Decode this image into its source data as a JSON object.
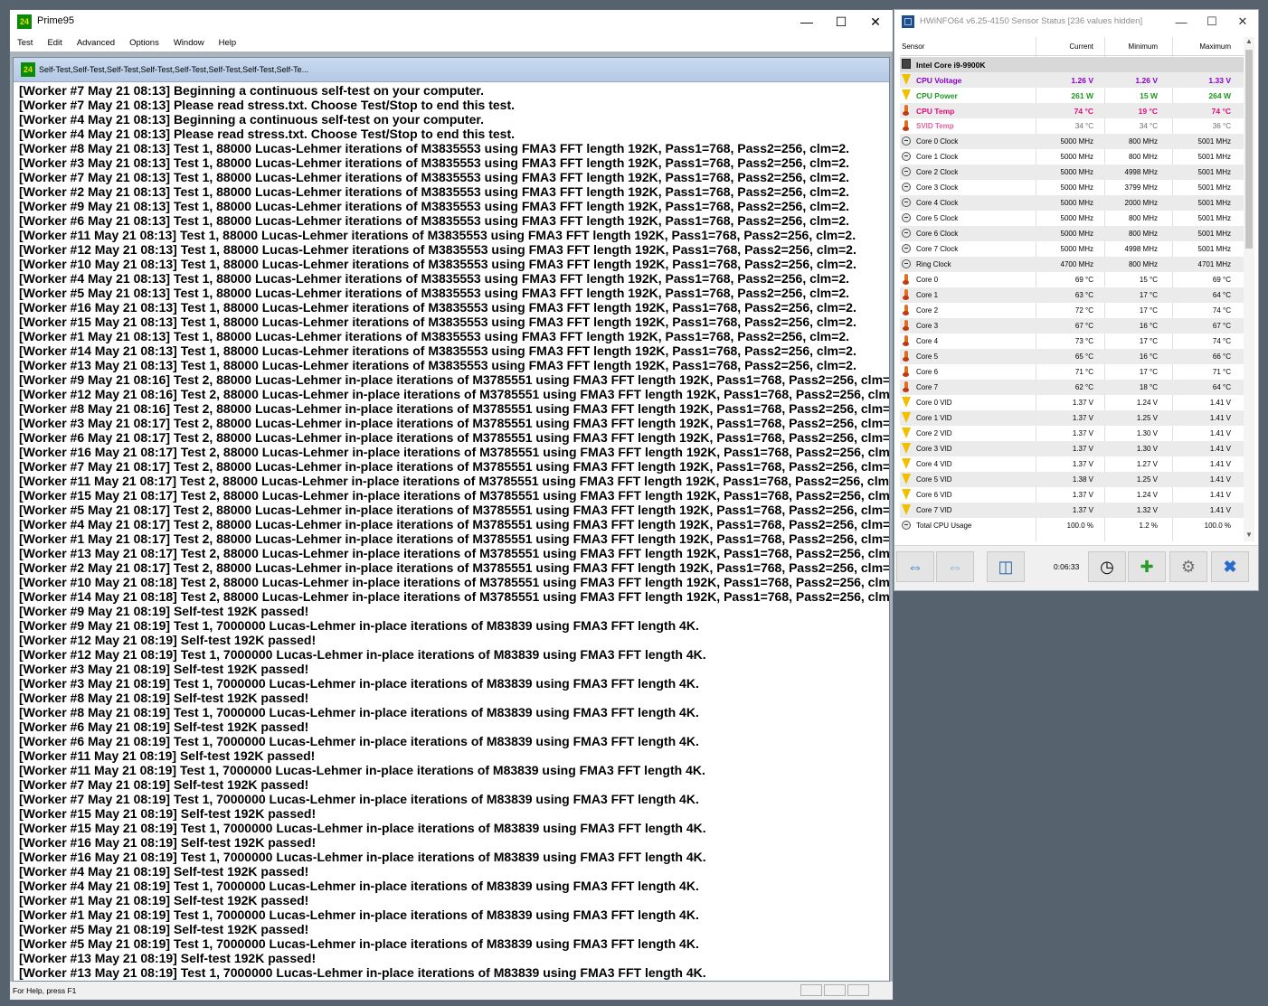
{
  "prime95": {
    "title": "Prime95",
    "menu": [
      "Test",
      "Edit",
      "Advanced",
      "Options",
      "Window",
      "Help"
    ],
    "child_title": "Self-Test,Self-Test,Self-Test,Self-Test,Self-Test,Self-Test,Self-Test,Self-Te...",
    "status_text": "For Help, press F1",
    "log": [
      "[Worker #7 May 21 08:13] Beginning a continuous self-test on your computer.",
      "[Worker #7 May 21 08:13] Please read stress.txt.  Choose Test/Stop to end this test.",
      "[Worker #4 May 21 08:13] Beginning a continuous self-test on your computer.",
      "[Worker #4 May 21 08:13] Please read stress.txt.  Choose Test/Stop to end this test.",
      "[Worker #8 May 21 08:13] Test 1, 88000 Lucas-Lehmer iterations of M3835553 using FMA3 FFT length 192K, Pass1=768, Pass2=256, clm=2.",
      "[Worker #3 May 21 08:13] Test 1, 88000 Lucas-Lehmer iterations of M3835553 using FMA3 FFT length 192K, Pass1=768, Pass2=256, clm=2.",
      "[Worker #7 May 21 08:13] Test 1, 88000 Lucas-Lehmer iterations of M3835553 using FMA3 FFT length 192K, Pass1=768, Pass2=256, clm=2.",
      "[Worker #2 May 21 08:13] Test 1, 88000 Lucas-Lehmer iterations of M3835553 using FMA3 FFT length 192K, Pass1=768, Pass2=256, clm=2.",
      "[Worker #9 May 21 08:13] Test 1, 88000 Lucas-Lehmer iterations of M3835553 using FMA3 FFT length 192K, Pass1=768, Pass2=256, clm=2.",
      "[Worker #6 May 21 08:13] Test 1, 88000 Lucas-Lehmer iterations of M3835553 using FMA3 FFT length 192K, Pass1=768, Pass2=256, clm=2.",
      "[Worker #11 May 21 08:13] Test 1, 88000 Lucas-Lehmer iterations of M3835553 using FMA3 FFT length 192K, Pass1=768, Pass2=256, clm=2.",
      "[Worker #12 May 21 08:13] Test 1, 88000 Lucas-Lehmer iterations of M3835553 using FMA3 FFT length 192K, Pass1=768, Pass2=256, clm=2.",
      "[Worker #10 May 21 08:13] Test 1, 88000 Lucas-Lehmer iterations of M3835553 using FMA3 FFT length 192K, Pass1=768, Pass2=256, clm=2.",
      "[Worker #4 May 21 08:13] Test 1, 88000 Lucas-Lehmer iterations of M3835553 using FMA3 FFT length 192K, Pass1=768, Pass2=256, clm=2.",
      "[Worker #5 May 21 08:13] Test 1, 88000 Lucas-Lehmer iterations of M3835553 using FMA3 FFT length 192K, Pass1=768, Pass2=256, clm=2.",
      "[Worker #16 May 21 08:13] Test 1, 88000 Lucas-Lehmer iterations of M3835553 using FMA3 FFT length 192K, Pass1=768, Pass2=256, clm=2.",
      "[Worker #15 May 21 08:13] Test 1, 88000 Lucas-Lehmer iterations of M3835553 using FMA3 FFT length 192K, Pass1=768, Pass2=256, clm=2.",
      "[Worker #1 May 21 08:13] Test 1, 88000 Lucas-Lehmer iterations of M3835553 using FMA3 FFT length 192K, Pass1=768, Pass2=256, clm=2.",
      "[Worker #14 May 21 08:13] Test 1, 88000 Lucas-Lehmer iterations of M3835553 using FMA3 FFT length 192K, Pass1=768, Pass2=256, clm=2.",
      "[Worker #13 May 21 08:13] Test 1, 88000 Lucas-Lehmer iterations of M3835553 using FMA3 FFT length 192K, Pass1=768, Pass2=256, clm=2.",
      "[Worker #9 May 21 08:16] Test 2, 88000 Lucas-Lehmer in-place iterations of M3785551 using FMA3 FFT length 192K, Pass1=768, Pass2=256, clm=2",
      "[Worker #12 May 21 08:16] Test 2, 88000 Lucas-Lehmer in-place iterations of M3785551 using FMA3 FFT length 192K, Pass1=768, Pass2=256, clm",
      "[Worker #8 May 21 08:16] Test 2, 88000 Lucas-Lehmer in-place iterations of M3785551 using FMA3 FFT length 192K, Pass1=768, Pass2=256, clm=",
      "[Worker #3 May 21 08:17] Test 2, 88000 Lucas-Lehmer in-place iterations of M3785551 using FMA3 FFT length 192K, Pass1=768, Pass2=256, clm=",
      "[Worker #6 May 21 08:17] Test 2, 88000 Lucas-Lehmer in-place iterations of M3785551 using FMA3 FFT length 192K, Pass1=768, Pass2=256, clm=",
      "[Worker #16 May 21 08:17] Test 2, 88000 Lucas-Lehmer in-place iterations of M3785551 using FMA3 FFT length 192K, Pass1=768, Pass2=256, clm=",
      "[Worker #7 May 21 08:17] Test 2, 88000 Lucas-Lehmer in-place iterations of M3785551 using FMA3 FFT length 192K, Pass1=768, Pass2=256, clm=",
      "[Worker #11 May 21 08:17] Test 2, 88000 Lucas-Lehmer in-place iterations of M3785551 using FMA3 FFT length 192K, Pass1=768, Pass2=256, clm=",
      "[Worker #15 May 21 08:17] Test 2, 88000 Lucas-Lehmer in-place iterations of M3785551 using FMA3 FFT length 192K, Pass1=768, Pass2=256, clm=",
      "[Worker #5 May 21 08:17] Test 2, 88000 Lucas-Lehmer in-place iterations of M3785551 using FMA3 FFT length 192K, Pass1=768, Pass2=256, clm=",
      "[Worker #4 May 21 08:17] Test 2, 88000 Lucas-Lehmer in-place iterations of M3785551 using FMA3 FFT length 192K, Pass1=768, Pass2=256, clm=",
      "[Worker #1 May 21 08:17] Test 2, 88000 Lucas-Lehmer in-place iterations of M3785551 using FMA3 FFT length 192K, Pass1=768, Pass2=256, clm=",
      "[Worker #13 May 21 08:17] Test 2, 88000 Lucas-Lehmer in-place iterations of M3785551 using FMA3 FFT length 192K, Pass1=768, Pass2=256, clm=",
      "[Worker #2 May 21 08:17] Test 2, 88000 Lucas-Lehmer in-place iterations of M3785551 using FMA3 FFT length 192K, Pass1=768, Pass2=256, clm=",
      "[Worker #10 May 21 08:18] Test 2, 88000 Lucas-Lehmer in-place iterations of M3785551 using FMA3 FFT length 192K, Pass1=768, Pass2=256, clm=",
      "[Worker #14 May 21 08:18] Test 2, 88000 Lucas-Lehmer in-place iterations of M3785551 using FMA3 FFT length 192K, Pass1=768, Pass2=256, clm=",
      "[Worker #9 May 21 08:19] Self-test 192K passed!",
      "[Worker #9 May 21 08:19] Test 1, 7000000 Lucas-Lehmer in-place iterations of M83839 using FMA3 FFT length 4K.",
      "[Worker #12 May 21 08:19] Self-test 192K passed!",
      "[Worker #12 May 21 08:19] Test 1, 7000000 Lucas-Lehmer in-place iterations of M83839 using FMA3 FFT length 4K.",
      "[Worker #3 May 21 08:19] Self-test 192K passed!",
      "[Worker #3 May 21 08:19] Test 1, 7000000 Lucas-Lehmer in-place iterations of M83839 using FMA3 FFT length 4K.",
      "[Worker #8 May 21 08:19] Self-test 192K passed!",
      "[Worker #8 May 21 08:19] Test 1, 7000000 Lucas-Lehmer in-place iterations of M83839 using FMA3 FFT length 4K.",
      "[Worker #6 May 21 08:19] Self-test 192K passed!",
      "[Worker #6 May 21 08:19] Test 1, 7000000 Lucas-Lehmer in-place iterations of M83839 using FMA3 FFT length 4K.",
      "[Worker #11 May 21 08:19] Self-test 192K passed!",
      "[Worker #11 May 21 08:19] Test 1, 7000000 Lucas-Lehmer in-place iterations of M83839 using FMA3 FFT length 4K.",
      "[Worker #7 May 21 08:19] Self-test 192K passed!",
      "[Worker #7 May 21 08:19] Test 1, 7000000 Lucas-Lehmer in-place iterations of M83839 using FMA3 FFT length 4K.",
      "[Worker #15 May 21 08:19] Self-test 192K passed!",
      "[Worker #15 May 21 08:19] Test 1, 7000000 Lucas-Lehmer in-place iterations of M83839 using FMA3 FFT length 4K.",
      "[Worker #16 May 21 08:19] Self-test 192K passed!",
      "[Worker #16 May 21 08:19] Test 1, 7000000 Lucas-Lehmer in-place iterations of M83839 using FMA3 FFT length 4K.",
      "[Worker #4 May 21 08:19] Self-test 192K passed!",
      "[Worker #4 May 21 08:19] Test 1, 7000000 Lucas-Lehmer in-place iterations of M83839 using FMA3 FFT length 4K.",
      "[Worker #1 May 21 08:19] Self-test 192K passed!",
      "[Worker #1 May 21 08:19] Test 1, 7000000 Lucas-Lehmer in-place iterations of M83839 using FMA3 FFT length 4K.",
      "[Worker #5 May 21 08:19] Self-test 192K passed!",
      "[Worker #5 May 21 08:19] Test 1, 7000000 Lucas-Lehmer in-place iterations of M83839 using FMA3 FFT length 4K.",
      "[Worker #13 May 21 08:19] Self-test 192K passed!",
      "[Worker #13 May 21 08:19] Test 1, 7000000 Lucas-Lehmer in-place iterations of M83839 using FMA3 FFT length 4K."
    ]
  },
  "hwinfo": {
    "title": "HWiNFO64 v6.25-4150 Sensor Status [236 values hidden]",
    "columns": {
      "sensor": "Sensor",
      "current": "Current",
      "minimum": "Minimum",
      "maximum": "Maximum"
    },
    "timer": "0:06:33",
    "colors": {
      "voltage": "#8a00c8",
      "power": "#1a9a1a",
      "temp": "#e0107a",
      "svid": "#e060a0"
    },
    "rows": [
      {
        "name": "Intel Core i9-9900K",
        "cur": "",
        "min": "",
        "max": "",
        "icon": "chip-icon",
        "style": "header",
        "color": ""
      },
      {
        "name": "CPU Voltage",
        "cur": "1.26 V",
        "min": "1.26 V",
        "max": "1.33 V",
        "icon": "voltage-icon",
        "style": "bold",
        "color": "#8a00c8"
      },
      {
        "name": "CPU Power",
        "cur": "261 W",
        "min": "15 W",
        "max": "264 W",
        "icon": "voltage-icon",
        "style": "bold",
        "color": "#1a9a1a"
      },
      {
        "name": "CPU Temp",
        "cur": "74 °C",
        "min": "19 °C",
        "max": "74 °C",
        "icon": "thermometer-icon",
        "style": "bold",
        "color": "#e0107a"
      },
      {
        "name": "SVID Temp",
        "cur": "34 °C",
        "min": "34 °C",
        "max": "36 °C",
        "icon": "thermometer-icon",
        "style": "svid",
        "color": "#e060a0"
      },
      {
        "name": "Core 0 Clock",
        "cur": "5000 MHz",
        "min": "800 MHz",
        "max": "5001 MHz",
        "icon": "clock-icon",
        "style": "",
        "color": ""
      },
      {
        "name": "Core 1 Clock",
        "cur": "5000 MHz",
        "min": "800 MHz",
        "max": "5001 MHz",
        "icon": "clock-icon",
        "style": "",
        "color": ""
      },
      {
        "name": "Core 2 Clock",
        "cur": "5000 MHz",
        "min": "4998 MHz",
        "max": "5001 MHz",
        "icon": "clock-icon",
        "style": "",
        "color": ""
      },
      {
        "name": "Core 3 Clock",
        "cur": "5000 MHz",
        "min": "3799 MHz",
        "max": "5001 MHz",
        "icon": "clock-icon",
        "style": "",
        "color": ""
      },
      {
        "name": "Core 4 Clock",
        "cur": "5000 MHz",
        "min": "2000 MHz",
        "max": "5001 MHz",
        "icon": "clock-icon",
        "style": "",
        "color": ""
      },
      {
        "name": "Core 5 Clock",
        "cur": "5000 MHz",
        "min": "800 MHz",
        "max": "5001 MHz",
        "icon": "clock-icon",
        "style": "",
        "color": ""
      },
      {
        "name": "Core 6 Clock",
        "cur": "5000 MHz",
        "min": "800 MHz",
        "max": "5001 MHz",
        "icon": "clock-icon",
        "style": "",
        "color": ""
      },
      {
        "name": "Core 7 Clock",
        "cur": "5000 MHz",
        "min": "4998 MHz",
        "max": "5001 MHz",
        "icon": "clock-icon",
        "style": "",
        "color": ""
      },
      {
        "name": "Ring Clock",
        "cur": "4700 MHz",
        "min": "800 MHz",
        "max": "4701 MHz",
        "icon": "clock-icon",
        "style": "",
        "color": ""
      },
      {
        "name": "Core 0",
        "cur": "69 °C",
        "min": "15 °C",
        "max": "69 °C",
        "icon": "thermometer-icon",
        "style": "",
        "color": ""
      },
      {
        "name": "Core 1",
        "cur": "63 °C",
        "min": "17 °C",
        "max": "64 °C",
        "icon": "thermometer-icon",
        "style": "",
        "color": ""
      },
      {
        "name": "Core 2",
        "cur": "72 °C",
        "min": "17 °C",
        "max": "74 °C",
        "icon": "thermometer-icon",
        "style": "",
        "color": ""
      },
      {
        "name": "Core 3",
        "cur": "67 °C",
        "min": "16 °C",
        "max": "67 °C",
        "icon": "thermometer-icon",
        "style": "",
        "color": ""
      },
      {
        "name": "Core 4",
        "cur": "73 °C",
        "min": "17 °C",
        "max": "74 °C",
        "icon": "thermometer-icon",
        "style": "",
        "color": ""
      },
      {
        "name": "Core 5",
        "cur": "65 °C",
        "min": "16 °C",
        "max": "66 °C",
        "icon": "thermometer-icon",
        "style": "",
        "color": ""
      },
      {
        "name": "Core 6",
        "cur": "71 °C",
        "min": "17 °C",
        "max": "71 °C",
        "icon": "thermometer-icon",
        "style": "",
        "color": ""
      },
      {
        "name": "Core 7",
        "cur": "62 °C",
        "min": "18 °C",
        "max": "64 °C",
        "icon": "thermometer-icon",
        "style": "",
        "color": ""
      },
      {
        "name": "Core 0 VID",
        "cur": "1.37 V",
        "min": "1.24 V",
        "max": "1.41 V",
        "icon": "voltage-icon",
        "style": "",
        "color": ""
      },
      {
        "name": "Core 1 VID",
        "cur": "1.37 V",
        "min": "1.25 V",
        "max": "1.41 V",
        "icon": "voltage-icon",
        "style": "",
        "color": ""
      },
      {
        "name": "Core 2 VID",
        "cur": "1.37 V",
        "min": "1.30 V",
        "max": "1.41 V",
        "icon": "voltage-icon",
        "style": "",
        "color": ""
      },
      {
        "name": "Core 3 VID",
        "cur": "1.37 V",
        "min": "1.30 V",
        "max": "1.41 V",
        "icon": "voltage-icon",
        "style": "",
        "color": ""
      },
      {
        "name": "Core 4 VID",
        "cur": "1.37 V",
        "min": "1.27 V",
        "max": "1.41 V",
        "icon": "voltage-icon",
        "style": "",
        "color": ""
      },
      {
        "name": "Core 5 VID",
        "cur": "1.38 V",
        "min": "1.25 V",
        "max": "1.41 V",
        "icon": "voltage-icon",
        "style": "",
        "color": ""
      },
      {
        "name": "Core 6 VID",
        "cur": "1.37 V",
        "min": "1.24 V",
        "max": "1.41 V",
        "icon": "voltage-icon",
        "style": "",
        "color": ""
      },
      {
        "name": "Core 7 VID",
        "cur": "1.37 V",
        "min": "1.32 V",
        "max": "1.41 V",
        "icon": "voltage-icon",
        "style": "",
        "color": ""
      },
      {
        "name": "Total CPU Usage",
        "cur": "100.0 %",
        "min": "1.2 %",
        "max": "100.0 %",
        "icon": "clock-icon",
        "style": "",
        "color": ""
      }
    ]
  }
}
